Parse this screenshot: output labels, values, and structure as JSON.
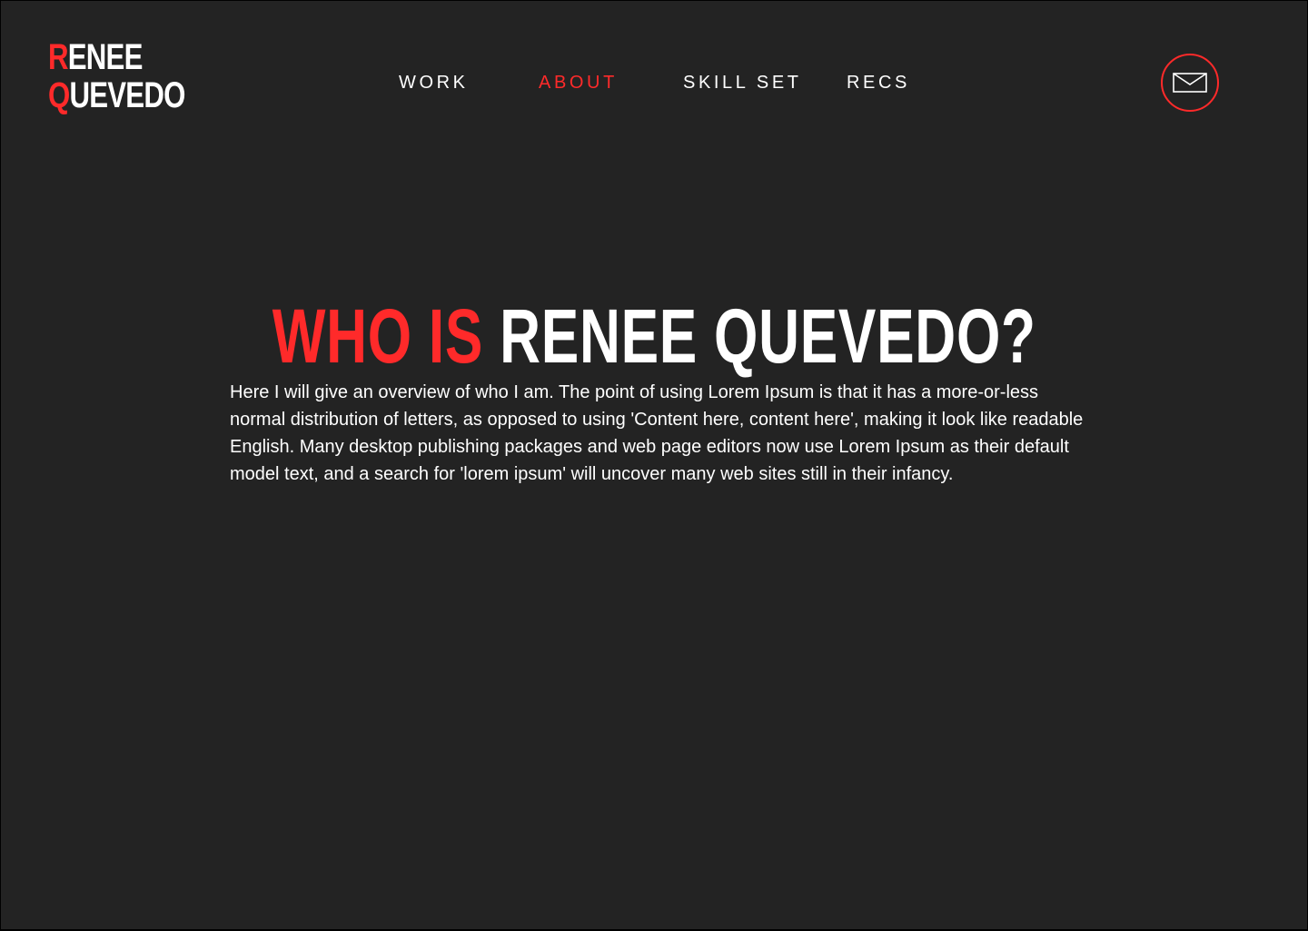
{
  "logo": {
    "line1_initial": "R",
    "line1_rest": "ENEE",
    "line2_initial": "Q",
    "line2_rest": "UEVEDO"
  },
  "nav": {
    "items": [
      {
        "label": "WORK",
        "active": false
      },
      {
        "label": "ABOUT",
        "active": true
      },
      {
        "label": "SKILL SET",
        "active": false
      },
      {
        "label": "RECS",
        "active": false
      }
    ]
  },
  "contact": {
    "icon": "mail-icon"
  },
  "heading": {
    "accent": "WHO IS",
    "rest": "RENEE QUEVEDO?"
  },
  "intro": {
    "text": "Here I will give an overview of who I am. The point of using Lorem Ipsum is that it has a more-or-less normal distribution of letters, as opposed to using 'Content here, content here', making it look like readable English. Many desktop publishing packages and web page editors now use Lorem Ipsum as their default model text, and a search for 'lorem ipsum' will uncover many web sites still in their infancy."
  },
  "colors": {
    "background": "#232323",
    "accent": "#ff2a2a",
    "text": "#ffffff"
  }
}
